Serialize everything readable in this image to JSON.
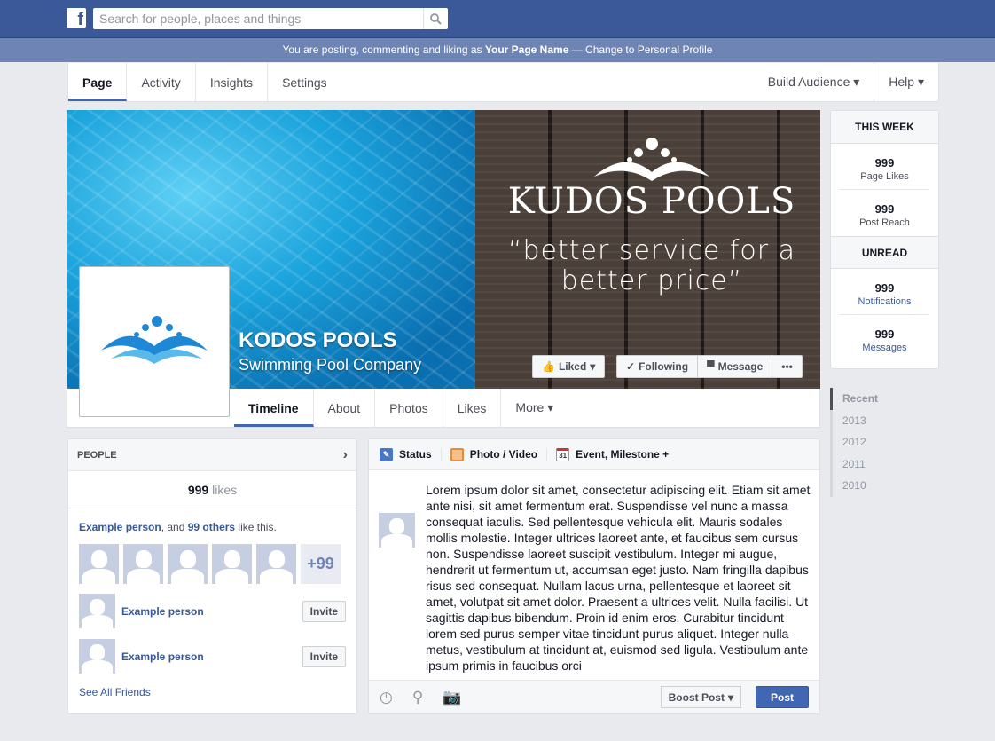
{
  "header": {
    "search_placeholder": "Search for people, places and things",
    "logo": "f"
  },
  "notice": {
    "prefix": "You are posting, commenting and liking as ",
    "page_name": "Your Page Name",
    "suffix": " — Change to Personal Profile"
  },
  "page_nav": {
    "items": [
      "Page",
      "Activity",
      "Insights",
      "Settings"
    ],
    "right": [
      "Build Audience ▾",
      "Help ▾"
    ]
  },
  "cover": {
    "brand": "KUDOS POOLS",
    "tagline": "“better service for a better price”",
    "page_name": "KODOS POOLS",
    "category": "Swimming Pool Company"
  },
  "cover_buttons": {
    "liked": "Liked",
    "following": "Following",
    "message": "Message",
    "more": "•••"
  },
  "timeline_nav": [
    "Timeline",
    "About",
    "Photos",
    "Likes",
    "More ▾"
  ],
  "side": {
    "this_week": "THIS WEEK",
    "page_likes_value": "999",
    "page_likes": "Page Likes",
    "post_reach_value": "999",
    "post_reach": "Post Reach",
    "unread": "UNREAD",
    "notifications_value": "999",
    "notifications": "Notifications",
    "messages_value": "999",
    "messages": "Messages"
  },
  "years": [
    "Recent",
    "2013",
    "2012",
    "2011",
    "2010"
  ],
  "people": {
    "title": "PEOPLE",
    "likes_count": "999",
    "likes_label": " likes",
    "friend_name": "Example person",
    "and": ", and ",
    "others": "99 others",
    "like_this": " like this.",
    "more_count": "+99",
    "suggestions": [
      {
        "name": "Example person",
        "action": "Invite"
      },
      {
        "name": "Example person",
        "action": "Invite"
      }
    ],
    "see_all": "See All Friends"
  },
  "composer": {
    "tabs": [
      "Status",
      "Photo / Video",
      "Event, Milestone +"
    ],
    "calendar_day": "31",
    "text": "Lorem ipsum dolor sit amet, consectetur adipiscing elit. Etiam sit amet ante nisi, sit amet fermentum erat. Suspendisse vel nunc a massa consequat iaculis. Sed pellentesque vehicula elit. Mauris sodales mollis molestie. Integer ultrices laoreet ante, et faucibus sem cursus non. Suspendisse laoreet suscipit vestibulum. Integer mi augue, hendrerit ut fermentum ut, accumsan eget justo. Nam fringilla dapibus risus sed consequat. Nullam lacus urna, pellentesque et laoreet sit amet, volutpat sit amet dolor. Praesent a ultrices velit. Nulla facilisi. Ut sagittis dapibus bibendum. Proin id enim eros. Curabitur tincidunt lorem sed purus semper vitae tincidunt purus aliquet. Integer nulla metus, vestibulum at tincidunt at, euismod sed ligula. Vestibulum ante ipsum primis in faucibus orci",
    "boost": "Boost Post",
    "post": "Post"
  }
}
